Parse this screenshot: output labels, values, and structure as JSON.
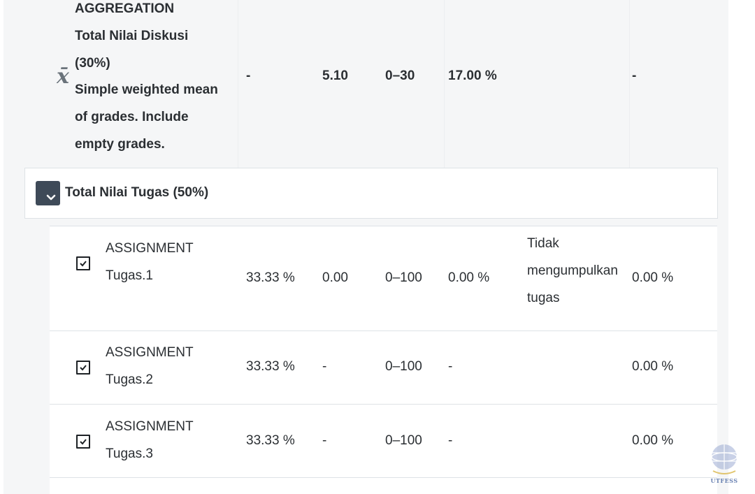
{
  "aggregation": {
    "type_label": "AGGREGATION",
    "name_line1": "Total Nilai Diskusi",
    "name_line2": "(30%)",
    "desc_line1": "Simple weighted mean",
    "desc_line2": "of grades. Include",
    "desc_line3": "empty grades.",
    "weight": "-",
    "grade": "5.10",
    "range": "0–30",
    "percentage": "17.00 %",
    "contribution": "-",
    "icon": "sigma-mean-icon"
  },
  "category": {
    "label": "Total Nilai Tugas (50%)",
    "toggle_icon": "chevron-down-icon"
  },
  "items": [
    {
      "type_label": "ASSIGNMENT",
      "name": "Tugas.1",
      "weight": "33.33 %",
      "grade": "0.00",
      "range": "0–100",
      "percentage": "0.00 %",
      "feedback_line1": "Tidak",
      "feedback_line2": "mengumpulkan",
      "feedback_line3": "tugas",
      "contribution": "0.00 %"
    },
    {
      "type_label": "ASSIGNMENT",
      "name": "Tugas.2",
      "weight": "33.33 %",
      "grade": "-",
      "range": "0–100",
      "percentage": "-",
      "contribution": "0.00 %"
    },
    {
      "type_label": "ASSIGNMENT",
      "name": "Tugas.3",
      "weight": "33.33 %",
      "grade": "-",
      "range": "0–100",
      "percentage": "-",
      "contribution": "0.00 %"
    }
  ],
  "logo": {
    "text": "UTFESS",
    "icon": "globe-logo-icon"
  }
}
